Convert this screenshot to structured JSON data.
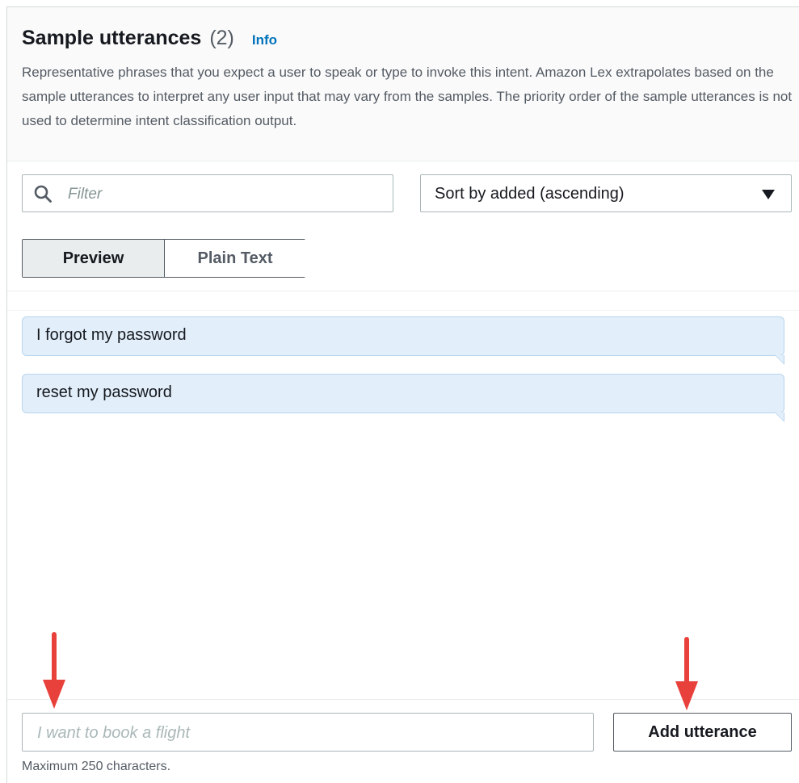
{
  "header": {
    "title": "Sample utterances",
    "count": "(2)",
    "info_link": "Info",
    "description": "Representative phrases that you expect a user to speak or type to invoke this intent. Amazon Lex extrapolates based on the sample utterances to interpret any user input that may vary from the samples. The priority order of the sample utterances is not used to determine intent classification output."
  },
  "filter": {
    "placeholder": "Filter",
    "icon": "search-icon"
  },
  "sort": {
    "selected": "Sort by added (ascending)",
    "icon": "caret-down-icon"
  },
  "view_toggle": {
    "preview_label": "Preview",
    "plain_text_label": "Plain Text",
    "active": "Preview"
  },
  "utterances": [
    "I forgot my password",
    "reset my password"
  ],
  "new_utterance": {
    "placeholder": "I want to book a flight",
    "value": "",
    "add_button_label": "Add utterance",
    "hint": "Maximum 250 characters."
  },
  "colors": {
    "accent_link": "#0073bb",
    "utterance_bubble": "#e2effa",
    "annotation_arrow": "#e8413c"
  }
}
